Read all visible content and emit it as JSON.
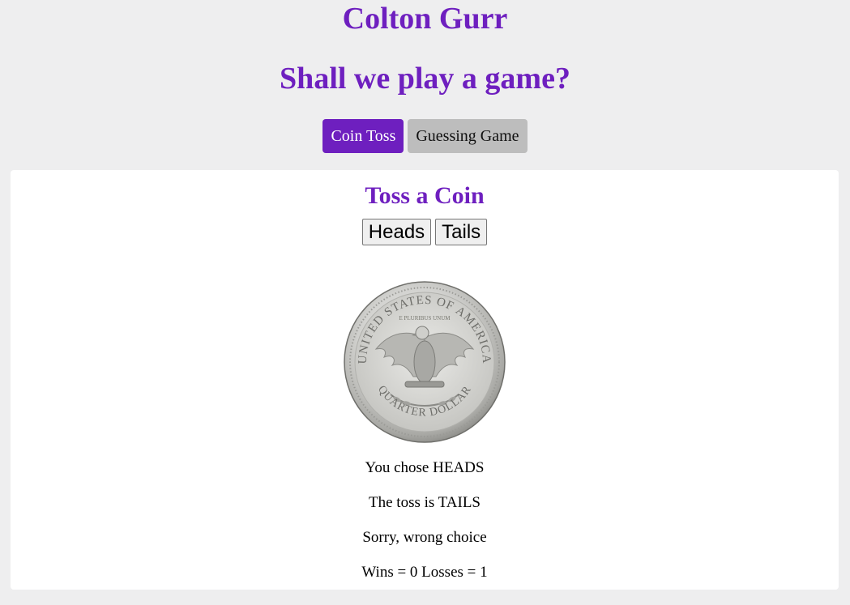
{
  "header": {
    "name": "Colton Gurr",
    "subtitle": "Shall we play a game?"
  },
  "tabs": [
    {
      "label": "Coin Toss",
      "active": true
    },
    {
      "label": "Guessing Game",
      "active": false
    }
  ],
  "coin_toss": {
    "title": "Toss a Coin",
    "buttons": {
      "heads": "Heads",
      "tails": "Tails"
    },
    "coin_image": "quarter-dollar-tails-image",
    "results": {
      "choice": "You chose HEADS",
      "toss": "The toss is TAILS",
      "outcome": "Sorry, wrong choice",
      "score": "Wins = 0 Losses = 1"
    }
  },
  "colors": {
    "accent": "#6e1fbf",
    "tab_inactive": "#bdbdbd",
    "page_background": "#eeeeef",
    "panel_background": "#ffffff"
  }
}
